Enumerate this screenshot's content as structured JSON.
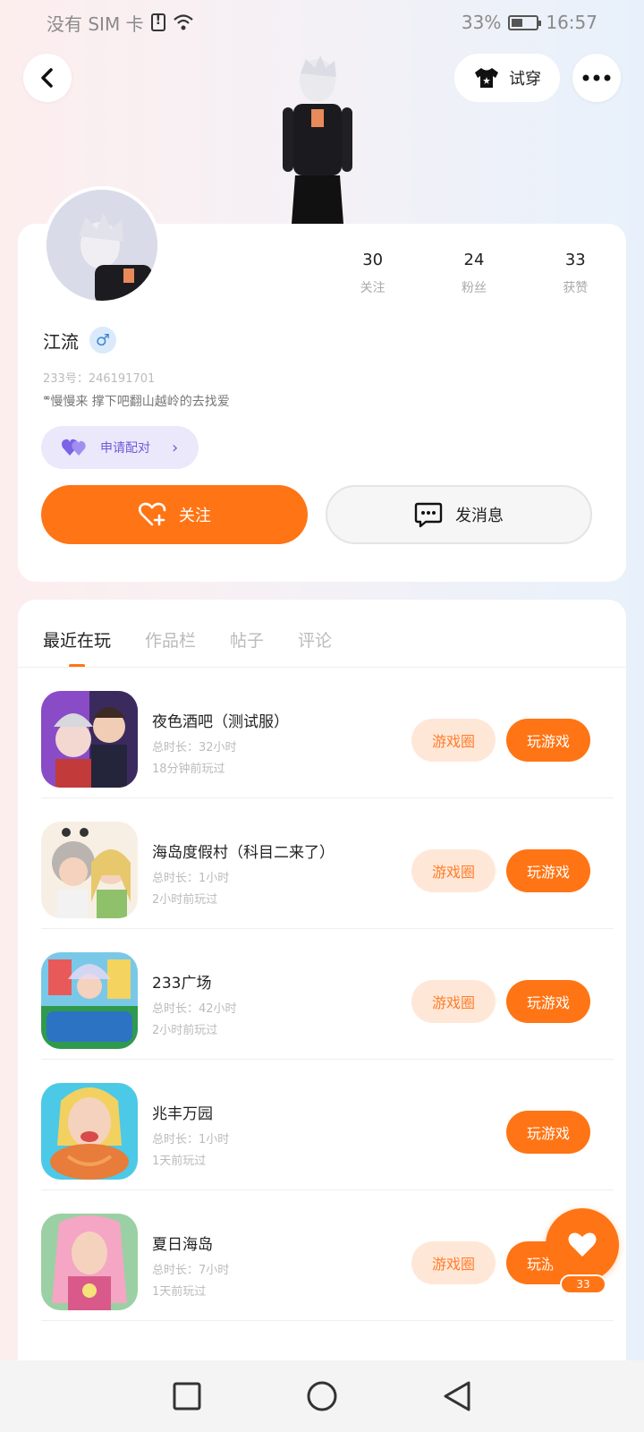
{
  "status_bar": {
    "carrier": "没有 SIM 卡",
    "battery_pct": "33%",
    "time": "16:57"
  },
  "header": {
    "try_on_label": "试穿"
  },
  "profile": {
    "stats": [
      {
        "value": "30",
        "label": "关注"
      },
      {
        "value": "24",
        "label": "粉丝"
      },
      {
        "value": "33",
        "label": "获赞"
      }
    ],
    "name": "江流",
    "gender_symbol": "♂",
    "uid": "233号：246191701",
    "bio_prefix": "∞",
    "bio": "慢慢来 撑下吧翻山越岭的去找爱",
    "pair_label": "申请配对",
    "follow_label": "关注",
    "message_label": "发消息"
  },
  "tabs": [
    {
      "label": "最近在玩",
      "active": true
    },
    {
      "label": "作品栏",
      "active": false
    },
    {
      "label": "帖子",
      "active": false
    },
    {
      "label": "评论",
      "active": false
    }
  ],
  "games": [
    {
      "name": "夜色酒吧（测试服）",
      "duration": "总时长：32小时",
      "last_played": "18分钟前玩过",
      "has_circle": true,
      "icon_colors": [
        "#8a4bc7",
        "#3b2a5e"
      ]
    },
    {
      "name": "海岛度假村（科目二来了）",
      "duration": "总时长：1小时",
      "last_played": "2小时前玩过",
      "has_circle": true,
      "icon_colors": [
        "#f2e7d6",
        "#e8c86d"
      ]
    },
    {
      "name": "233广场",
      "duration": "总时长：42小时",
      "last_played": "2小时前玩过",
      "has_circle": true,
      "icon_colors": [
        "#7ac8e8",
        "#2f9a4e"
      ]
    },
    {
      "name": "兆丰万园",
      "duration": "总时长：1小时",
      "last_played": "1天前玩过",
      "has_circle": false,
      "icon_colors": [
        "#4cc9e6",
        "#e87c3a"
      ]
    },
    {
      "name": "夏日海岛",
      "duration": "总时长：7小时",
      "last_played": "1天前玩过",
      "has_circle": true,
      "icon_colors": [
        "#f4a6c4",
        "#d95a8a"
      ]
    }
  ],
  "game_actions": {
    "circle_label": "游戏圈",
    "play_label": "玩游戏"
  },
  "fab": {
    "like_count": "33"
  },
  "colors": {
    "accent": "#ff7414",
    "accent_soft": "#ffe7d8",
    "pair_bg": "#ece8fc"
  }
}
